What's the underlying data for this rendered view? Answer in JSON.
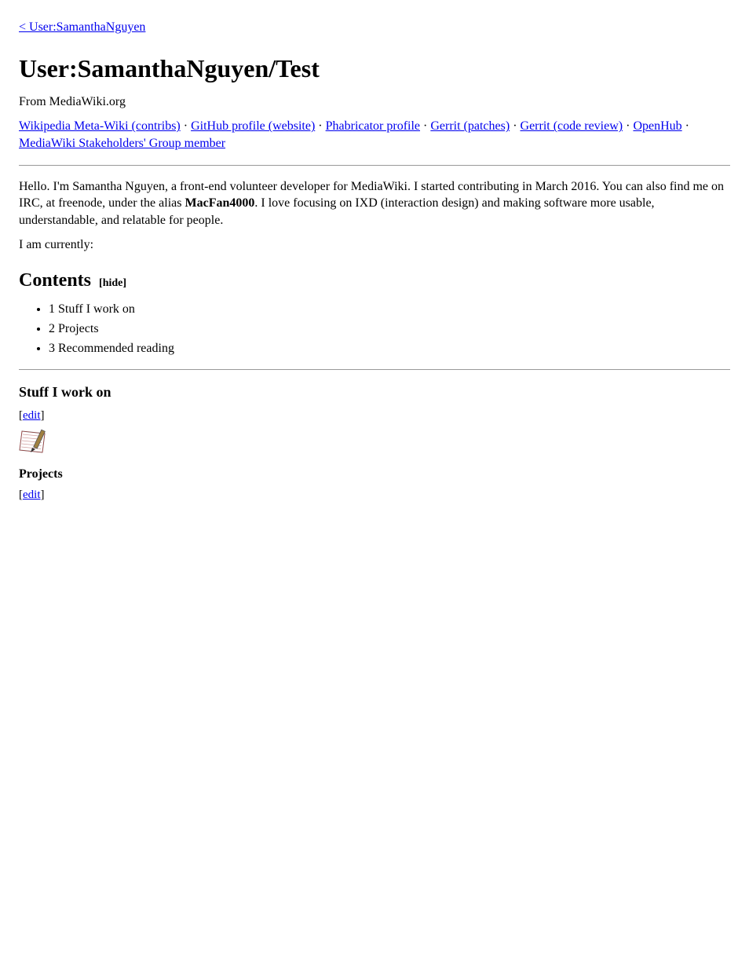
{
  "top_link": "< User:SamanthaNguyen",
  "page_title": "User:SamanthaNguyen/Test",
  "breadcrumb": "From MediaWiki.org",
  "nav_links": [
    "Wikipedia Meta-Wiki (contribs)",
    "GitHub profile (website)",
    "Phabricator profile",
    "Gerrit (patches)",
    "Gerrit (code review)",
    "OpenHub",
    "MediaWiki Stakeholders' Group member"
  ],
  "paragraph_intro_1": "Hello. ",
  "paragraph_intro_2": "I'm Samantha Nguyen, a front-end volunteer developer for MediaWiki. I started contributing in March 2016. You can also find me on IRC, at freenode, under the alias ",
  "alias": "MacFan4000",
  "paragraph_intro_3": ". I love focusing on IXD (interaction design) and making software more usable, understandable, and relatable for people.",
  "paragraph_list_intro": "I am currently:",
  "contents_header": "Contents",
  "hide_label": "hide",
  "contents_items": [
    "1 Stuff I work on",
    "2 Projects",
    "3 Recommended reading"
  ],
  "section1_title": "Stuff I work on",
  "section1_edit": "edit",
  "section1_sub_title": "Projects",
  "section1_sub_edit": "edit"
}
